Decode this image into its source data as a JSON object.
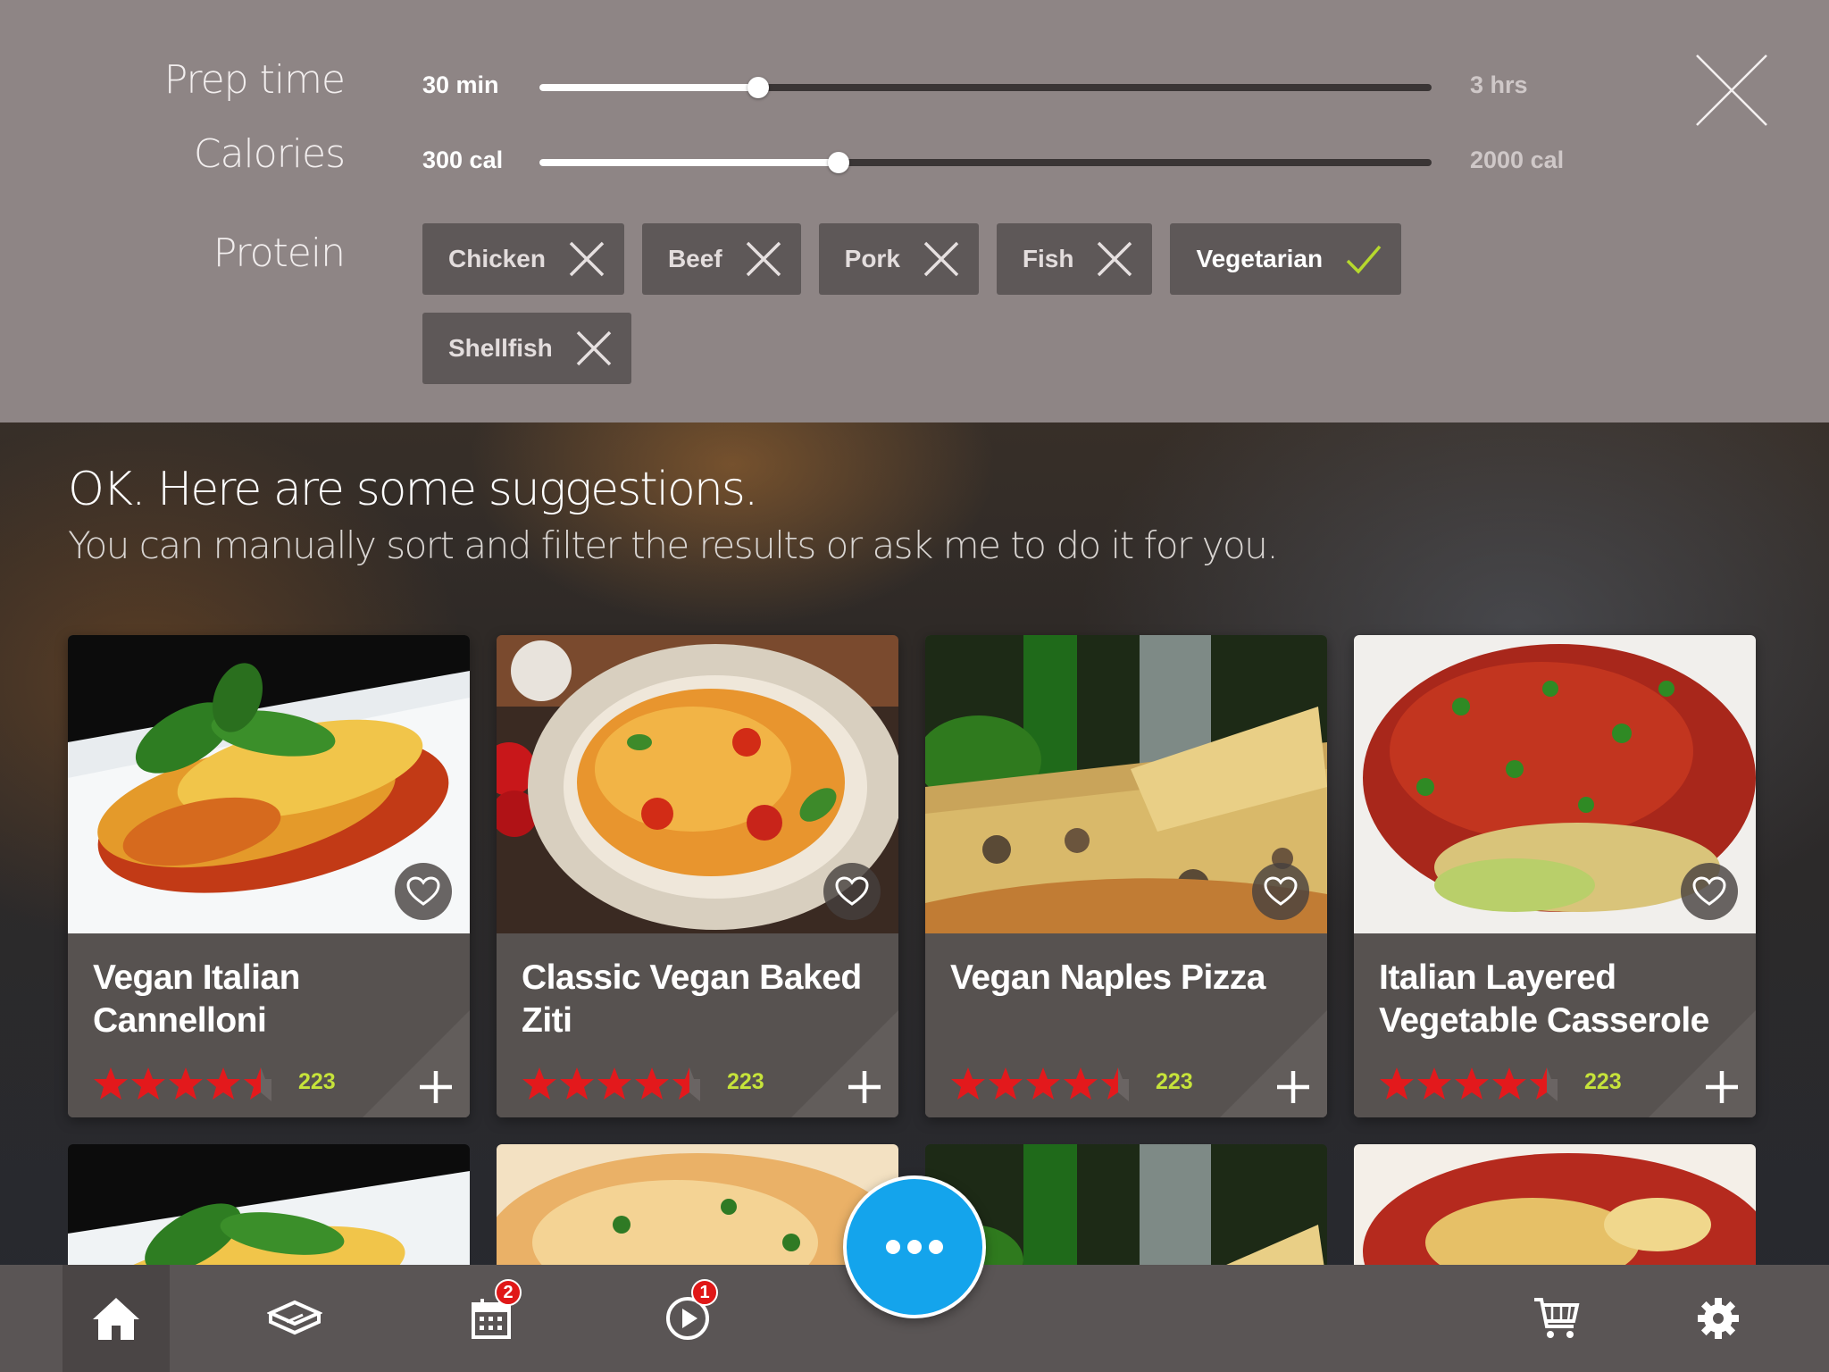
{
  "filters": {
    "prep_time": {
      "label": "Prep time",
      "value_label": "30 min",
      "max_label": "3 hrs",
      "fraction": 0.245
    },
    "calories": {
      "label": "Calories",
      "value_label": "300 cal",
      "max_label": "2000 cal",
      "fraction": 0.335
    },
    "protein": {
      "label": "Protein",
      "chips": [
        {
          "label": "Chicken",
          "selected": false,
          "icon": "close-icon"
        },
        {
          "label": "Beef",
          "selected": false,
          "icon": "close-icon"
        },
        {
          "label": "Pork",
          "selected": false,
          "icon": "close-icon"
        },
        {
          "label": "Fish",
          "selected": false,
          "icon": "close-icon"
        },
        {
          "label": "Vegetarian",
          "selected": true,
          "icon": "check-icon"
        },
        {
          "label": "Shellfish",
          "selected": false,
          "icon": "close-icon"
        }
      ]
    },
    "close_icon": "close-icon"
  },
  "suggestions": {
    "headline": "OK. Here are some suggestions.",
    "subline": "You can manually sort and filter the results or ask me to do it for you."
  },
  "recipes": [
    {
      "title": "Vegan Italian Cannelloni",
      "rating": 4.5,
      "reviews": "223",
      "image": "cannelloni"
    },
    {
      "title": "Classic Vegan Baked Ziti",
      "rating": 4.5,
      "reviews": "223",
      "image": "ziti"
    },
    {
      "title": "Vegan Naples Pizza",
      "rating": 4.5,
      "reviews": "223",
      "image": "pizza"
    },
    {
      "title": "Italian Layered Vegetable Casserole",
      "rating": 4.5,
      "reviews": "223",
      "image": "casserole"
    }
  ],
  "nav": {
    "items": [
      {
        "name": "home",
        "icon": "home-icon",
        "active": true
      },
      {
        "name": "recipes",
        "icon": "book-icon",
        "active": false
      },
      {
        "name": "calendar",
        "icon": "calendar-icon",
        "badge": "2"
      },
      {
        "name": "play",
        "icon": "play-icon",
        "badge": "1"
      },
      {
        "name": "cart",
        "icon": "cart-icon"
      },
      {
        "name": "settings",
        "icon": "gear-icon"
      }
    ],
    "fab_icon": "more-icon"
  },
  "colors": {
    "accent_blue": "#14a4ec",
    "star_red": "#e3191c",
    "count_green": "#c6e33a",
    "check_green": "#b6d92d",
    "badge_red": "#e01818",
    "panel_gray": "#8e8585"
  }
}
